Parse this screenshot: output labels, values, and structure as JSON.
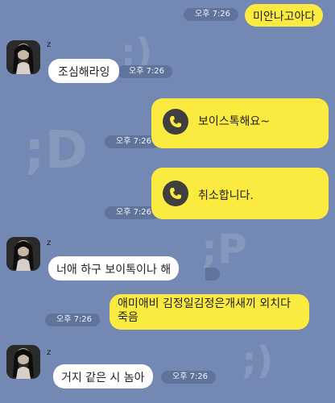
{
  "colors": {
    "background": "#7389b3",
    "my_bubble": "#fbea3f",
    "their_bubble": "#ffffff",
    "timestamp_pill": "#5f739b"
  },
  "watermarks": [
    ";)",
    ";D",
    ";P",
    ";)"
  ],
  "messages": [
    {
      "from": "me",
      "text": "미안나고아다",
      "time": "오후 7:26"
    },
    {
      "from": "z",
      "sender": "z",
      "text": "조심해라잉",
      "time": "오후 7:26"
    },
    {
      "from": "me",
      "type": "voice",
      "text": "보이스톡해요~",
      "time": "오후 7:26",
      "icon": "voice-call-icon"
    },
    {
      "from": "me",
      "type": "voice",
      "text": "취소합니다.",
      "time": "오후 7:26",
      "icon": "voice-call-icon"
    },
    {
      "from": "z",
      "sender": "z",
      "text": "너애  하구  보이톡이나 해",
      "time": ""
    },
    {
      "from": "me",
      "text_line1": "애미애비 김정일김정은개새끼 외치다",
      "text_line2": "죽음",
      "time": "오후 7:26"
    },
    {
      "from": "z",
      "sender": "z",
      "text": "거지 같은  시    놈아",
      "time": "오후 7:26"
    }
  ]
}
